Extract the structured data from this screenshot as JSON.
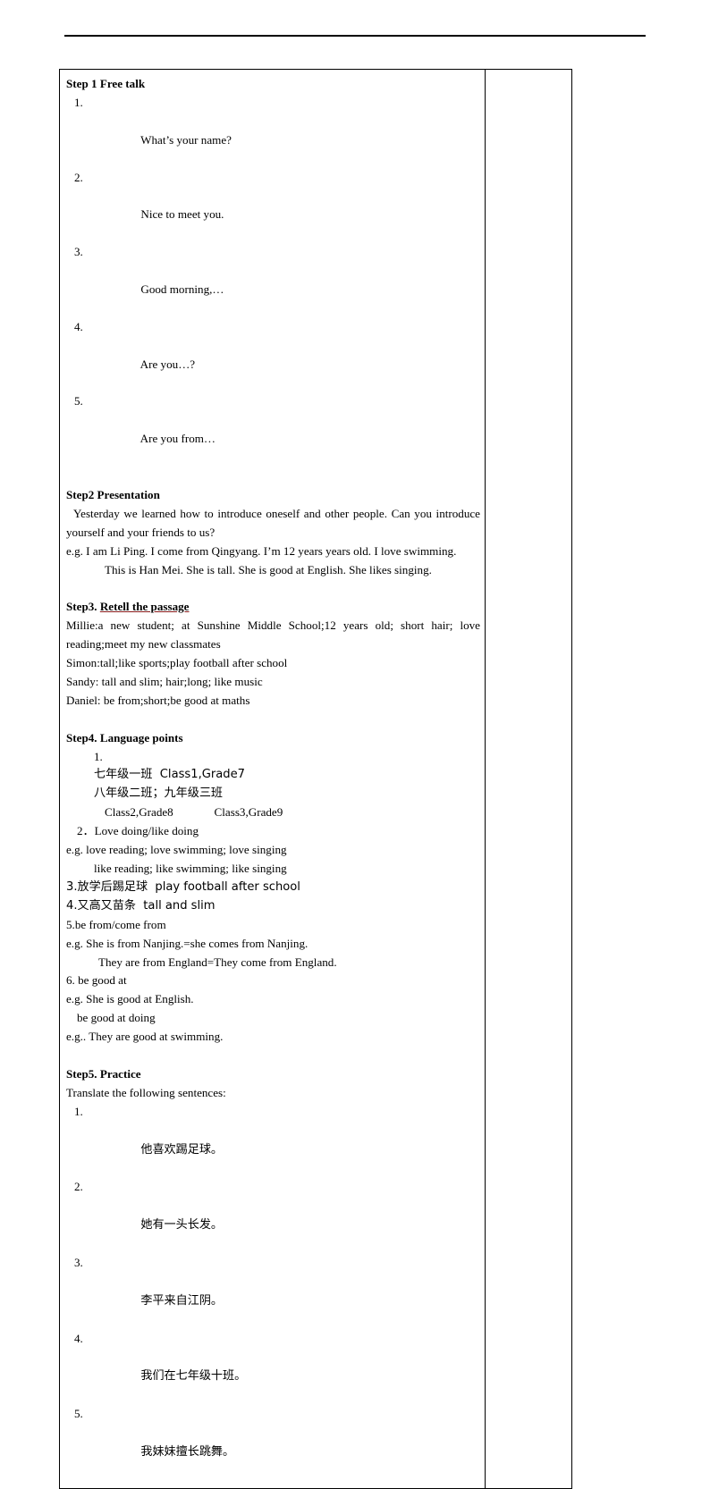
{
  "document": {
    "header_rule": true,
    "table": {
      "columns": [
        "main-content",
        "notes-empty"
      ],
      "side_column_content": ""
    }
  },
  "content": {
    "step1": {
      "heading": "Step 1 Free talk",
      "items": [
        {
          "num": "1.",
          "text": "What’s your name?"
        },
        {
          "num": "2.",
          "text": "Nice to meet you."
        },
        {
          "num": "3.",
          "text": "Good morning,…"
        },
        {
          "num": "4.",
          "text": "Are you…?"
        },
        {
          "num": "5.",
          "text": "Are you from…"
        }
      ]
    },
    "step2": {
      "heading": "Step2 Presentation",
      "intro": "Yesterday we learned how to introduce oneself and other people. Can you introduce yourself and your friends to us?",
      "example1": "e.g. I am Li Ping. I come from Qingyang. I’m 12 years years old. I love swimming.",
      "example2": "This is Han Mei. She is tall. She is good at English. She likes singing."
    },
    "step3": {
      "heading_prefix": "Step3. ",
      "heading_underlined": "Retell the passage",
      "lines": [
        "Millie:a new student; at Sunshine Middle School;12 years old; short hair; love reading;meet my new classmates",
        "Simon:tall;like sports;play football after school",
        "Sandy: tall and slim; hair;long; like music",
        "Daniel: be from;short;be good at maths"
      ]
    },
    "step4": {
      "heading": "Step4. Language points",
      "item1_num": "1.",
      "item1_line1": "七年级一班  Class1,Grade7",
      "item1_line2": "八年级二班；九年级三班",
      "item1_line3": "Class2,Grade8              Class3,Grade9",
      "item2": "2．Love doing/like doing",
      "item2_eg1": "e.g. love reading; love swimming; love singing",
      "item2_eg2": "like reading; like swimming; like singing",
      "item3": "3.放学后踢足球  play football after school",
      "item4": "4.又高又苗条  tall and slim",
      "item5": "5.be from/come from",
      "item5_eg1": "e.g. She is from Nanjing.=she comes from Nanjing.",
      "item5_eg2": "They are from England=They come from England.",
      "item6": "6. be good at",
      "item6_eg1": "e.g. She is good at English.",
      "item6_sub": "be good at doing",
      "item6_eg2": "e.g.. They are good at swimming."
    },
    "step5": {
      "heading": "Step5. Practice",
      "instruction": "Translate the following sentences:",
      "items": [
        {
          "num": "1.",
          "text": "他喜欢踢足球。"
        },
        {
          "num": "2.",
          "text": "她有一头长发。"
        },
        {
          "num": "3.",
          "text": "李平来自江阴。"
        },
        {
          "num": "4.",
          "text": "我们在七年级十班。"
        },
        {
          "num": "5.",
          "text": "我妹妹擅长跳舞。"
        }
      ]
    }
  },
  "colors": {
    "text": "#000000",
    "border": "#000000",
    "underline_accent": "#8a1c1c",
    "background": "#ffffff"
  }
}
